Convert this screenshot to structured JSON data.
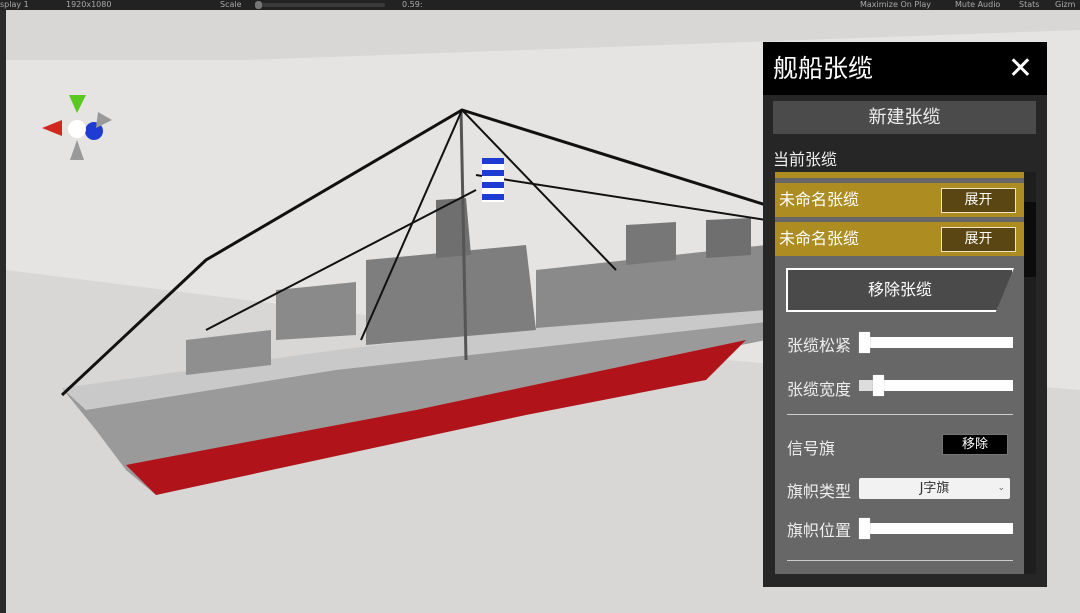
{
  "toolbar": {
    "display": "splay 1",
    "resolution": "1920x1080",
    "scale_label": "Scale",
    "scale_value": "0.59:",
    "maximize": "Maximize On Play",
    "mute": "Mute Audio",
    "stats": "Stats",
    "gizmos": "Gizm"
  },
  "panel": {
    "title": "舰船张缆",
    "close_icon": "close-icon",
    "new_button": "新建张缆",
    "current_label": "当前张缆",
    "cables": [
      {
        "name": "未命名张缆",
        "expand": "展开"
      },
      {
        "name": "未命名张缆",
        "expand": "展开"
      }
    ],
    "remove_cable": "移除张缆",
    "tension_label": "张缆松紧",
    "tension_value": 0,
    "width_label": "张缆宽度",
    "width_value": 0.1,
    "signal_flag_label": "信号旗",
    "remove_flag": "移除",
    "flag_type_label": "旗帜类型",
    "flag_type_value": "J字旗",
    "flag_pos_label": "旗帜位置",
    "flag_pos_value": 0
  },
  "colors": {
    "highlight": "#ad8d21",
    "hull_red": "#b0141a",
    "gizmo_y": "#5ac81e",
    "gizmo_x": "#d0281e",
    "gizmo_z": "#1e3cd2"
  }
}
